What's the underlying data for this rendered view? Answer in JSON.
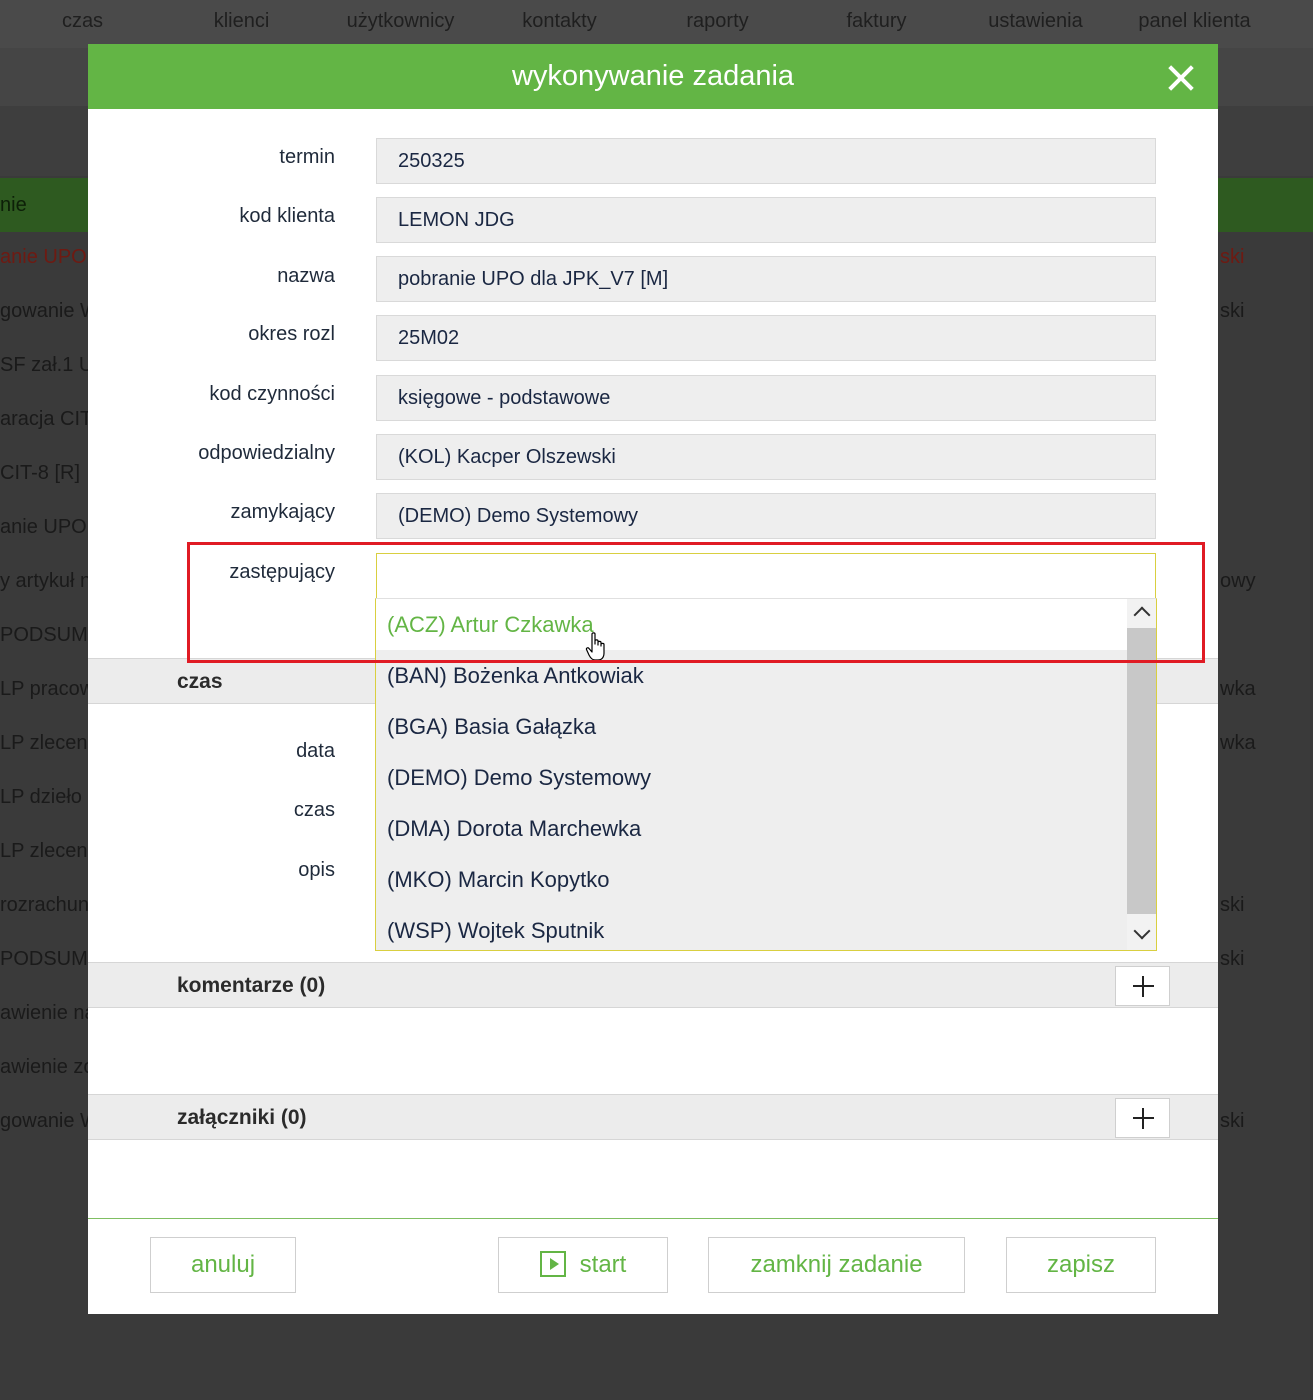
{
  "background": {
    "nav": [
      "czas",
      "klienci",
      "użytkownicy",
      "kontakty",
      "raporty",
      "faktury",
      "ustawienia",
      "panel klienta"
    ],
    "header_fragment": "nie",
    "rows": [
      {
        "left": "anie UPO",
        "right": "ski",
        "red": true
      },
      {
        "left": "gowanie W",
        "right": "ski",
        "red": false
      },
      {
        "left": "SF zał.1 U",
        "right": "",
        "red": false
      },
      {
        "left": "aracja CIT",
        "right": "",
        "red": false
      },
      {
        "left": "CIT-8 [R]",
        "right": "",
        "red": false
      },
      {
        "left": "anie UPO",
        "right": "",
        "red": false
      },
      {
        "left": "y artykuł n",
        "right": "owy",
        "red": false
      },
      {
        "left": "PODSUMO",
        "right": "",
        "red": false
      },
      {
        "left": "LP pracow",
        "right": "wka",
        "red": false
      },
      {
        "left": "LP zlecen",
        "right": "wka",
        "red": false
      },
      {
        "left": "LP dzieło",
        "right": "",
        "red": false
      },
      {
        "left": "LP zlecen",
        "right": "",
        "red": false
      },
      {
        "left": "rozrachun",
        "right": "ski",
        "red": false
      },
      {
        "left": "PODSUMO",
        "right": "ski",
        "red": false
      },
      {
        "left": "awienie na",
        "right": "",
        "red": false
      },
      {
        "left": "awienie zo",
        "right": "",
        "red": false
      },
      {
        "left": "gowanie W",
        "right": "ski",
        "red": false
      }
    ]
  },
  "modal": {
    "title": "wykonywanie zadania",
    "fields": [
      {
        "label": "termin",
        "value": "250325"
      },
      {
        "label": "kod klienta",
        "value": "LEMON JDG"
      },
      {
        "label": "nazwa",
        "value": "pobranie UPO dla JPK_V7 [M]"
      },
      {
        "label": "okres rozl",
        "value": "25M02"
      },
      {
        "label": "kod czynności",
        "value": "księgowe - podstawowe"
      },
      {
        "label": "odpowiedzialny",
        "value": "(KOL) Kacper Olszewski"
      },
      {
        "label": "zamykający",
        "value": "(DEMO) Demo Systemowy"
      },
      {
        "label": "zastępujący",
        "value": ""
      }
    ],
    "dropdown_options": [
      "(ACZ) Artur Czkawka",
      "(BAN) Bożenka Antkowiak",
      "(BGA) Basia Gałązka",
      "(DEMO) Demo Systemowy",
      "(DMA) Dorota Marchewka",
      "(MKO) Marcin Kopytko",
      "(WSP) Wojtek Sputnik"
    ],
    "time_section": {
      "title": "czas",
      "labels": [
        "data",
        "czas",
        "opis"
      ]
    },
    "comments_title": "komentarze (0)",
    "attachments_title": "załączniki (0)",
    "buttons": {
      "cancel": "anuluj",
      "start": "start",
      "close_task": "zamknij zadanie",
      "save": "zapisz"
    }
  },
  "colors": {
    "accent_green": "#63b545",
    "highlight_red": "#e01b24",
    "field_bg": "#eeeeee"
  }
}
